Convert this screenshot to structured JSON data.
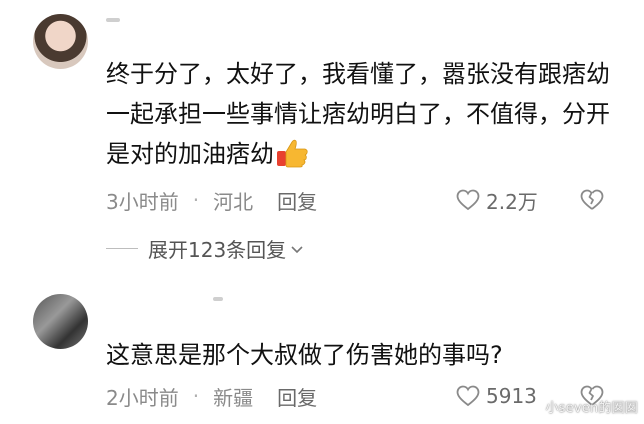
{
  "comments": [
    {
      "text": "终于分了，太好了，我看懂了，嚣张没有跟痞幼一起承担一些事情让痞幼明白了，不值得，分开是对的加油痞幼",
      "emoji": "thumbs-up",
      "time": "3小时前",
      "location": "河北",
      "reply_label": "回复",
      "likes": "2.2万"
    },
    {
      "text": "这意思是那个大叔做了伤害她的事吗?",
      "time": "2小时前",
      "location": "新疆",
      "reply_label": "回复",
      "likes": "5913"
    }
  ],
  "expand_replies": "展开123条回复",
  "watermark": "小seven的囡囡",
  "colors": {
    "meta_gray": "#8a8a8a",
    "text": "#111111",
    "background": "#ffffff"
  }
}
